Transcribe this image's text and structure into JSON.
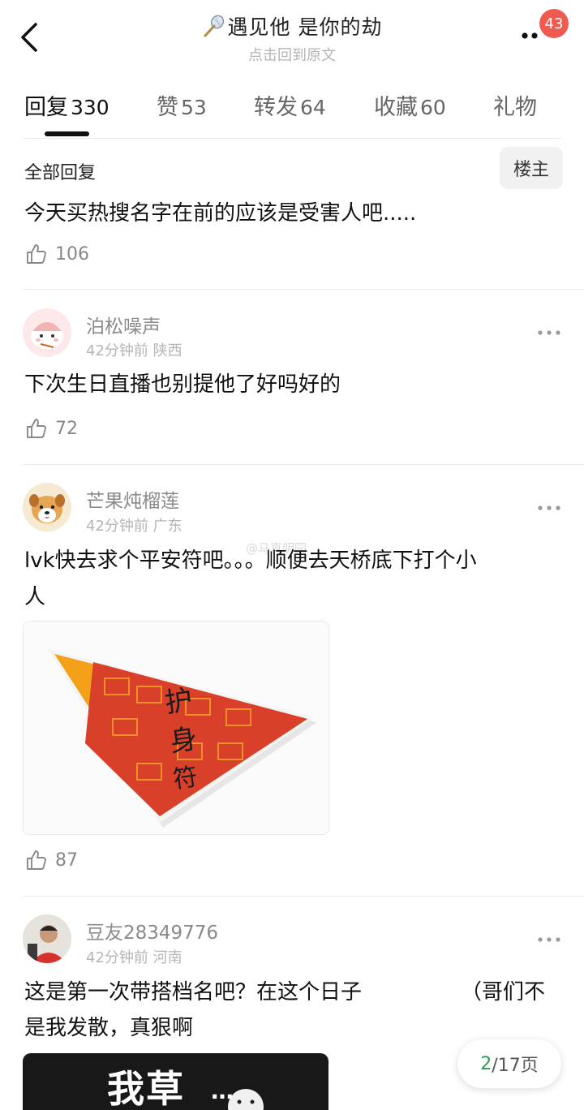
{
  "header": {
    "title": "遇见他 是你的劫",
    "subtitle": "点击回到原文",
    "notification_count": "43"
  },
  "tabs": [
    {
      "label": "回复",
      "count": "330"
    },
    {
      "label": "赞",
      "count": "53"
    },
    {
      "label": "转发",
      "count": "64"
    },
    {
      "label": "收藏",
      "count": "60"
    },
    {
      "label": "礼物",
      "count": ""
    }
  ],
  "section": {
    "label": "全部回复",
    "owner_button": "楼主"
  },
  "top_comment": {
    "text": "今天买热搜名字在前的应该是受害人吧.....",
    "likes": "106"
  },
  "comments": [
    {
      "username": "泊松噪声",
      "meta": "42分钟前 陕西",
      "text": "下次生日直播也别提他了好吗好的",
      "likes": "72"
    },
    {
      "username": "芒果炖榴莲",
      "meta": "42分钟前 广东",
      "text_line1": "lvk快去求个平安符吧。。。顺便去天桥底下打个小",
      "text_line2": "人",
      "image_label": "护身符",
      "likes": "87"
    },
    {
      "username": "豆友28349776",
      "meta": "42分钟前 河南",
      "text_line1": "这是第一次带搭档名吧？在这个日子",
      "text_line1b": "（哥们不",
      "text_line2": "是我发散，真狠啊",
      "meme_text": "我草"
    }
  ],
  "watermark": "@马真明园",
  "pagination": {
    "current": "2",
    "total": "/17页"
  },
  "colors": {
    "badge": "#f15b4f",
    "page_current": "#2aa050",
    "text_primary": "#111111",
    "text_secondary": "#8a8a8a"
  }
}
